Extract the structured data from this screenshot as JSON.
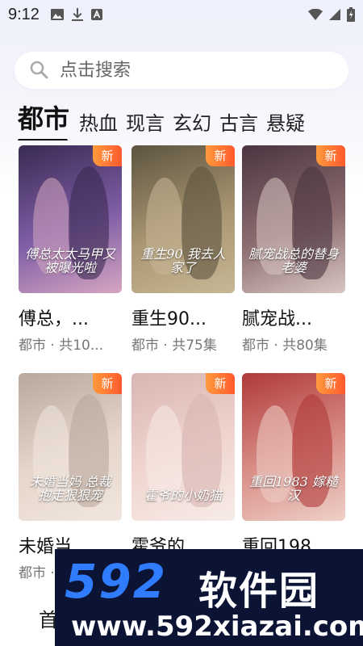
{
  "status": {
    "time": "9:12",
    "icons": [
      "image-icon",
      "download-icon",
      "text-a-icon"
    ],
    "right_icons": [
      "wifi-icon",
      "signal-icon",
      "battery-icon"
    ]
  },
  "search": {
    "placeholder": "点击搜索"
  },
  "tabs": [
    {
      "label": "都市",
      "active": true
    },
    {
      "label": "热血",
      "active": false
    },
    {
      "label": "现言",
      "active": false
    },
    {
      "label": "玄幻",
      "active": false
    },
    {
      "label": "古言",
      "active": false
    },
    {
      "label": "悬疑",
      "active": false
    }
  ],
  "badge_label": "新",
  "cards": [
    {
      "title": "傅总，...",
      "subtitle": "都市 · 共10...",
      "poster_text": "傅总太太马甲又被曝光啦",
      "colors": [
        "#3a2a52",
        "#7e5ea6",
        "#d6a5c0"
      ]
    },
    {
      "title": "重生90...",
      "subtitle": "都市 · 共75集",
      "poster_text": "重生90 我去人家了",
      "colors": [
        "#5d5440",
        "#a99672",
        "#c8b795"
      ]
    },
    {
      "title": "腻宠战...",
      "subtitle": "都市 · 共80集",
      "poster_text": "腻宠战总的替身老婆",
      "colors": [
        "#4b3540",
        "#8c6c70",
        "#d8c6c2"
      ]
    },
    {
      "title": "未婚当...",
      "subtitle": "都市 · 共...",
      "poster_text": "未婚当妈 总裁抱走狠狠宠",
      "colors": [
        "#b9a89c",
        "#e6d6cb",
        "#f1e6de"
      ]
    },
    {
      "title": "霍爷的...",
      "subtitle": "",
      "poster_text": "霍爷的小奶猫",
      "colors": [
        "#d9b5b2",
        "#f0d6cf",
        "#f7ebe8"
      ]
    },
    {
      "title": "重回198...",
      "subtitle": "",
      "poster_text": "重回1983 嫁糙汉",
      "colors": [
        "#b03a3a",
        "#d98f88",
        "#eed0c8"
      ]
    }
  ],
  "bottom_nav_peek": "首",
  "watermark": {
    "logo": "592",
    "chinese": "软件园",
    "url": "www.592xiazai.com"
  }
}
